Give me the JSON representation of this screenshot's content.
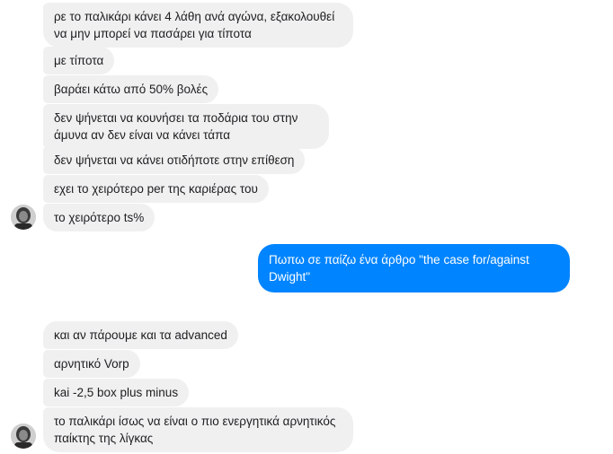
{
  "conversation": {
    "incoming_group_1": [
      "ρε το παλικάρι κάνει 4 λάθη ανά αγώνα, εξακολουθεί να μην μπορεί να πασάρει για τίποτα",
      "με τίποτα",
      "βαράει κάτω από 50% βολές",
      "δεν ψήνεται να κουνήσει τα ποδάρια του στην άμυνα αν δεν είναι να κάνει τάπα",
      "δεν ψήνεται να κάνει οτιδήποτε στην επίθεση",
      "εχει το χειρότερο per της καριέρας του",
      "το χειρότερο ts%"
    ],
    "outgoing": "Πωπω σε παίζω ένα άρθρο \"the case for/against Dwight\"",
    "incoming_group_2": [
      "και αν πάρουμε και τα advanced",
      "αρνητικό Vorp",
      "kai -2,5 box plus minus",
      "το παλικάρι ίσως να είναι ο πιο ενεργητικά αρνητικός παίκτης της λίγκας"
    ]
  },
  "colors": {
    "incoming_bubble": "#f1f0f0",
    "incoming_text": "#1c1e21",
    "outgoing_bubble": "#0084ff",
    "outgoing_text": "#ffffff"
  },
  "icons": {
    "contact_avatar": "user-avatar-photo"
  }
}
